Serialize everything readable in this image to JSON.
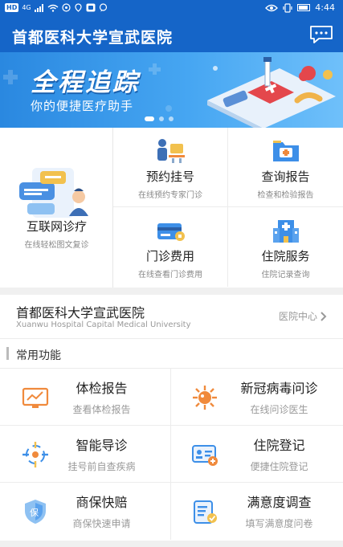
{
  "status_bar": {
    "left_chips": [
      "HD",
      "4G"
    ],
    "time": "4:44"
  },
  "header": {
    "title": "首都医科大学宣武医院",
    "message_icon": "chat-bubble-icon"
  },
  "banner": {
    "title": "全程追踪",
    "subtitle": "你的便捷医疗助手",
    "slide_count": 3,
    "active_slide": 1
  },
  "services": {
    "featured": {
      "label": "互联网诊疗",
      "sub": "在线轻松图文复诊",
      "icon": "online-consult-icon"
    },
    "items": [
      {
        "label": "预约挂号",
        "sub": "在线预约专家门诊",
        "icon": "appointment-icon"
      },
      {
        "label": "查询报告",
        "sub": "检查和检验报告",
        "icon": "report-folder-icon"
      },
      {
        "label": "门诊费用",
        "sub": "在线查看门诊费用",
        "icon": "payment-card-icon"
      },
      {
        "label": "住院服务",
        "sub": "住院记录查询",
        "icon": "hospital-building-icon"
      }
    ]
  },
  "hospital": {
    "name": "首都医科大学宣武医院",
    "name_en": "Xuanwu Hospital Capital Medical University",
    "link_label": "医院中心"
  },
  "common": {
    "title": "常用功能",
    "items": [
      {
        "label": "体检报告",
        "sub": "查看体检报告",
        "icon": "monitor-chart-icon"
      },
      {
        "label": "新冠病毒问诊",
        "sub": "在线问诊医生",
        "icon": "virus-icon"
      },
      {
        "label": "智能导诊",
        "sub": "挂号前自查疾病",
        "icon": "crosshair-guide-icon"
      },
      {
        "label": "住院登记",
        "sub": "便捷住院登记",
        "icon": "id-card-icon"
      },
      {
        "label": "商保快赔",
        "sub": "商保快速申请",
        "icon": "shield-icon"
      },
      {
        "label": "满意度调查",
        "sub": "填写满意度问卷",
        "icon": "survey-clipboard-icon"
      }
    ]
  },
  "colors": {
    "primary": "#1565c8",
    "accent_orange": "#f08a3c",
    "accent_blue": "#3d8fe8"
  }
}
